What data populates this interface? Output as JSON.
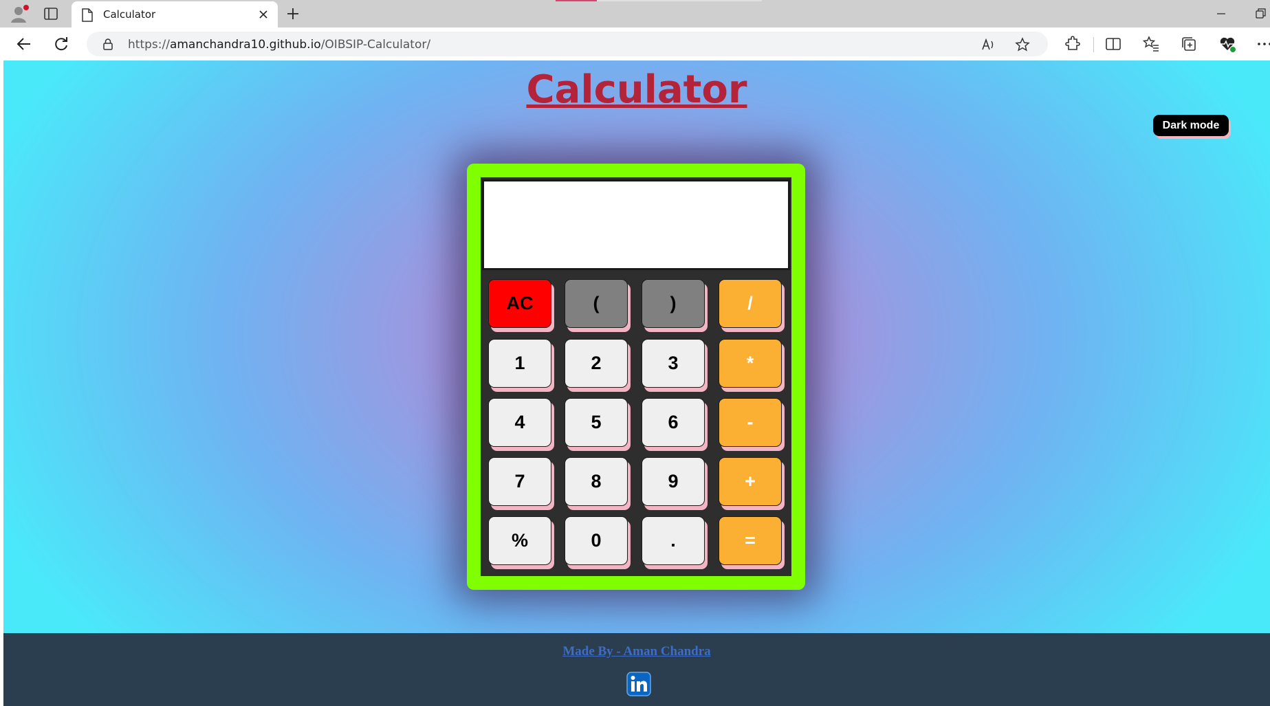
{
  "browser": {
    "tab_title": "Calculator",
    "url_prefix": "https://",
    "url_host": "amanchandra10.github.io",
    "url_path": "/OIBSIP-Calculator/"
  },
  "page": {
    "heading": "Calculator",
    "dark_mode_label": "Dark mode",
    "display_value": "",
    "footer_credit": "Made By - Aman Chandra"
  },
  "keys": [
    [
      "AC",
      "(",
      ")",
      "/"
    ],
    [
      "1",
      "2",
      "3",
      "*"
    ],
    [
      "4",
      "5",
      "6",
      "-"
    ],
    [
      "7",
      "8",
      "9",
      "+"
    ],
    [
      "%",
      "0",
      ".",
      "="
    ]
  ],
  "colors": {
    "heading": "#b3243b",
    "calc_border": "#7fff00",
    "clear_key": "#ff0000",
    "paren_key": "#808080",
    "operator_key": "#fbb034",
    "footer": "#2b3e4f"
  }
}
